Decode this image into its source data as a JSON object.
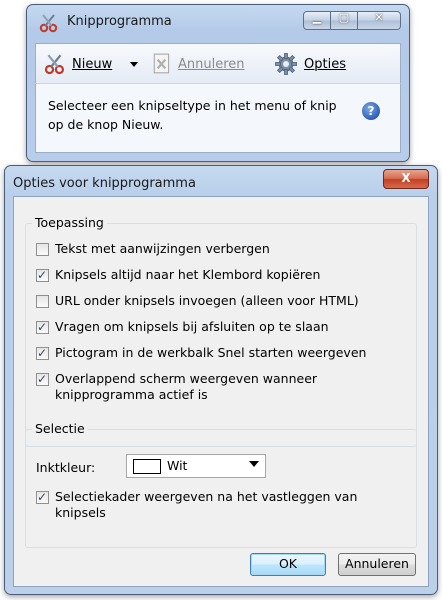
{
  "snipping": {
    "title": "Knipprogramma",
    "toolbar": {
      "new_label": "Nieuw",
      "cancel_label": "Annuleren",
      "options_label": "Opties"
    },
    "status_text": "Selecteer een knipseltype in het menu of knip op de knop Nieuw.",
    "help_glyph": "?"
  },
  "options": {
    "title": "Opties voor knipprogramma",
    "close_glyph": "X",
    "application_group": {
      "label": "Toepassing",
      "items": [
        {
          "label": "Tekst met aanwijzingen verbergen",
          "checked": false
        },
        {
          "label": "Knipsels altijd naar het Klembord kopiëren",
          "checked": true
        },
        {
          "label": "URL onder knipsels invoegen (alleen voor HTML)",
          "checked": false
        },
        {
          "label": "Vragen om knipsels bij afsluiten op te slaan",
          "checked": true
        },
        {
          "label": "Pictogram in de werkbalk Snel starten weergeven",
          "checked": true
        },
        {
          "label": "Overlappend scherm weergeven wanneer knipprogramma actief is",
          "checked": true
        }
      ]
    },
    "selection_group": {
      "label": "Selectie",
      "ink_label": "Inktkleur:",
      "ink_value": "Wit",
      "ink_color": "#ffffff",
      "border_item": {
        "label": "Selectiekader weergeven na het vastleggen van knipsels",
        "checked": true
      }
    },
    "ok_label": "OK",
    "cancel_label": "Annuleren"
  }
}
